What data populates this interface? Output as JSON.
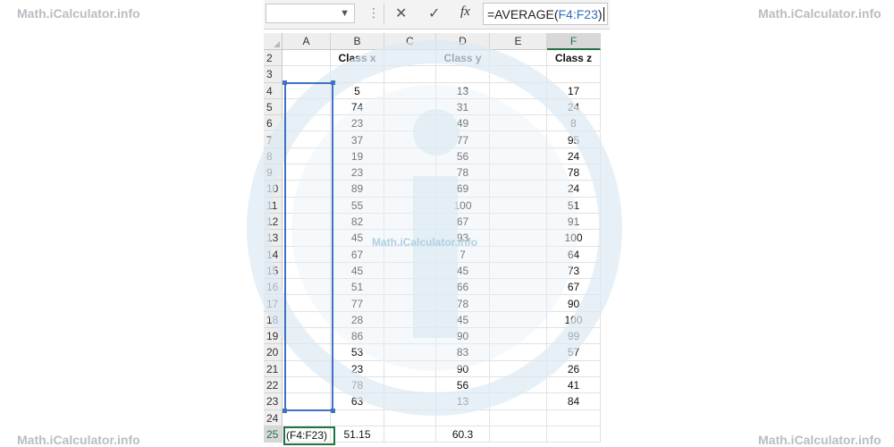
{
  "watermark": "Math.iCalculator.info",
  "formula_bar": {
    "formula_prefix": "=AVERAGE(",
    "formula_ref": "F4:F23",
    "formula_suffix": ")",
    "fx_label": "fx"
  },
  "columns": [
    "A",
    "B",
    "C",
    "D",
    "E",
    "F"
  ],
  "headers": {
    "row": "2",
    "class_x": "Class x",
    "class_y": "Class y",
    "class_z": "Class z"
  },
  "rows": [
    {
      "n": "3",
      "b": "",
      "d": "",
      "f": ""
    },
    {
      "n": "4",
      "b": "5",
      "d": "13",
      "f": "17"
    },
    {
      "n": "5",
      "b": "74",
      "d": "31",
      "f": "24"
    },
    {
      "n": "6",
      "b": "23",
      "d": "49",
      "f": "8"
    },
    {
      "n": "7",
      "b": "37",
      "d": "77",
      "f": "95"
    },
    {
      "n": "8",
      "b": "19",
      "d": "56",
      "f": "24"
    },
    {
      "n": "9",
      "b": "23",
      "d": "78",
      "f": "78"
    },
    {
      "n": "10",
      "b": "89",
      "d": "69",
      "f": "24"
    },
    {
      "n": "11",
      "b": "55",
      "d": "100",
      "f": "51"
    },
    {
      "n": "12",
      "b": "82",
      "d": "67",
      "f": "91"
    },
    {
      "n": "13",
      "b": "45",
      "d": "93",
      "f": "100"
    },
    {
      "n": "14",
      "b": "67",
      "d": "7",
      "f": "64"
    },
    {
      "n": "15",
      "b": "45",
      "d": "45",
      "f": "73"
    },
    {
      "n": "16",
      "b": "51",
      "d": "66",
      "f": "67"
    },
    {
      "n": "17",
      "b": "77",
      "d": "78",
      "f": "90"
    },
    {
      "n": "18",
      "b": "28",
      "d": "45",
      "f": "100"
    },
    {
      "n": "19",
      "b": "86",
      "d": "90",
      "f": "99"
    },
    {
      "n": "20",
      "b": "53",
      "d": "83",
      "f": "57"
    },
    {
      "n": "21",
      "b": "23",
      "d": "90",
      "f": "26"
    },
    {
      "n": "22",
      "b": "78",
      "d": "56",
      "f": "41"
    },
    {
      "n": "23",
      "b": "63",
      "d": "13",
      "f": "84"
    },
    {
      "n": "24",
      "b": "",
      "d": "",
      "f": ""
    },
    {
      "n": "25",
      "b": "51.15",
      "d": "60.3",
      "f": ""
    }
  ],
  "active_cell_text": "(F4:F23)",
  "colors": {
    "range_border": "#3f72c4",
    "active_border": "#217346",
    "watermark": "#dce9f2"
  }
}
